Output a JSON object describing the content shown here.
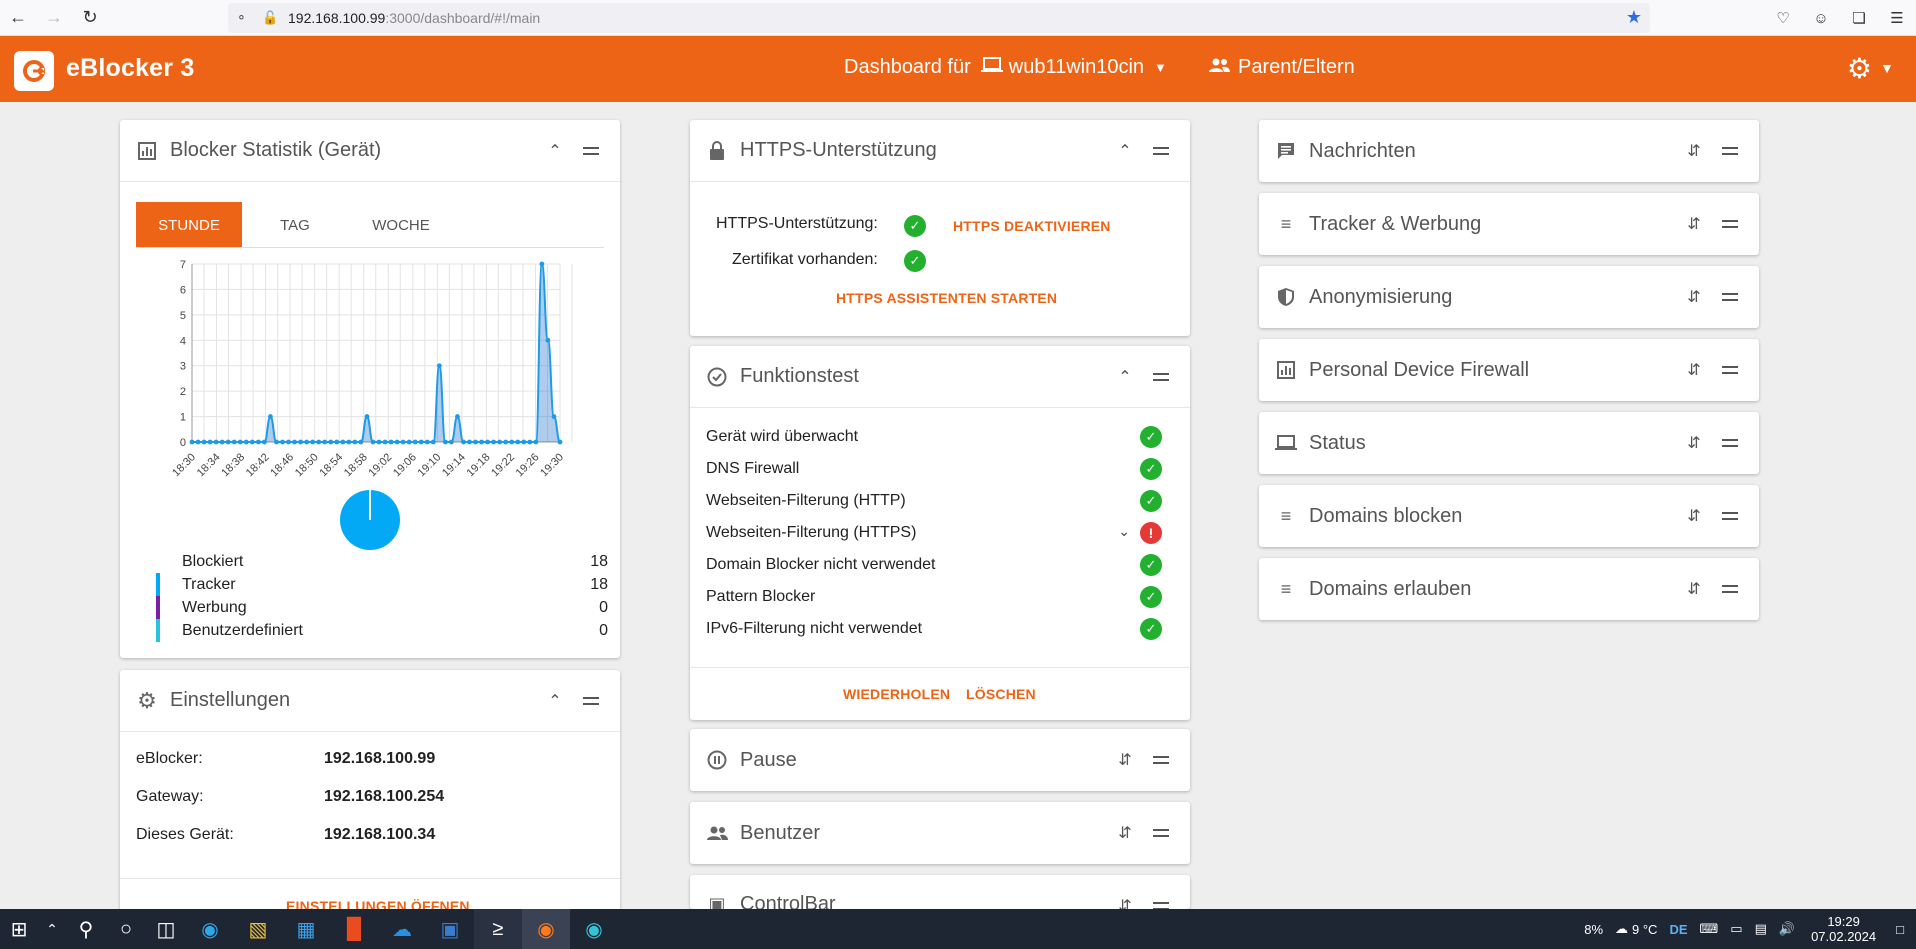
{
  "browser": {
    "url_host": "192.168.100.99",
    "url_path": ":3000/dashboard/#!/main"
  },
  "header": {
    "app_name": "eBlocker 3",
    "dashboard_label": "Dashboard für",
    "device_name": "wub11win10cin",
    "parent_label": "Parent/Eltern"
  },
  "blocker": {
    "title": "Blocker Statistik (Gerät)",
    "tabs": [
      "STUNDE",
      "TAG",
      "WOCHE"
    ],
    "active_tab": "STUNDE",
    "legend": [
      {
        "label": "Blockiert",
        "value": "18",
        "color": ""
      },
      {
        "label": "Tracker",
        "value": "18",
        "color": "#03a9f4"
      },
      {
        "label": "Werbung",
        "value": "0",
        "color": "#7b1fa2"
      },
      {
        "label": "Benutzerdefiniert",
        "value": "0",
        "color": "#26c6da"
      }
    ]
  },
  "chart_data": {
    "type": "area",
    "x": [
      "18:30",
      "18:34",
      "18:38",
      "18:42",
      "18:46",
      "18:50",
      "18:54",
      "18:58",
      "19:02",
      "19:06",
      "19:10",
      "19:14",
      "19:18",
      "19:22",
      "19:26",
      "19:30"
    ],
    "x_minutes_step": 1,
    "values": [
      0,
      0,
      0,
      0,
      0,
      0,
      0,
      0,
      0,
      0,
      0,
      0,
      0,
      1,
      0,
      0,
      0,
      0,
      0,
      0,
      0,
      0,
      0,
      0,
      0,
      0,
      0,
      0,
      0,
      1,
      0,
      0,
      0,
      0,
      0,
      0,
      0,
      0,
      0,
      0,
      0,
      3,
      0,
      0,
      1,
      0,
      0,
      0,
      0,
      0,
      0,
      0,
      0,
      0,
      0,
      0,
      0,
      0,
      7,
      4,
      1,
      0
    ],
    "ylim": [
      0,
      7
    ],
    "yticks": [
      0,
      1,
      2,
      3,
      4,
      5,
      6,
      7
    ],
    "grid": true,
    "series_color": "#1e9be8",
    "pie": {
      "slices": [
        {
          "label": "Tracker",
          "value": 18,
          "color": "#03a9f4"
        }
      ]
    }
  },
  "settings": {
    "title": "Einstellungen",
    "rows": [
      {
        "label": "eBlocker:",
        "value": "192.168.100.99"
      },
      {
        "label": "Gateway:",
        "value": "192.168.100.254"
      },
      {
        "label": "Dieses Gerät:",
        "value": "192.168.100.34"
      }
    ],
    "open_button": "EINSTELLUNGEN ÖFFNEN"
  },
  "https": {
    "title": "HTTPS-Unterstützung",
    "support_label": "HTTPS-Unterstützung:",
    "cert_label": "Zertifikat vorhanden:",
    "deactivate": "HTTPS DEAKTIVIEREN",
    "wizard": "HTTPS ASSISTENTEN STARTEN"
  },
  "functest": {
    "title": "Funktionstest",
    "items": [
      {
        "label": "Gerät wird überwacht",
        "status": "ok"
      },
      {
        "label": "DNS Firewall",
        "status": "ok"
      },
      {
        "label": "Webseiten-Filterung (HTTP)",
        "status": "ok"
      },
      {
        "label": "Webseiten-Filterung (HTTPS)",
        "status": "error"
      },
      {
        "label": "Domain Blocker nicht verwendet",
        "status": "ok"
      },
      {
        "label": "Pattern Blocker",
        "status": "ok"
      },
      {
        "label": "IPv6-Filterung nicht verwendet",
        "status": "ok"
      }
    ],
    "repeat": "WIEDERHOLEN",
    "delete": "LÖSCHEN"
  },
  "mid_cards": {
    "pause": "Pause",
    "users": "Benutzer",
    "controlbar": "ControlBar"
  },
  "right_cards": [
    {
      "title": "Nachrichten",
      "icon": "message-icon"
    },
    {
      "title": "Tracker & Werbung",
      "icon": "list-icon"
    },
    {
      "title": "Anonymisierung",
      "icon": "shield-icon"
    },
    {
      "title": "Personal Device Firewall",
      "icon": "bar-chart-icon"
    },
    {
      "title": "Status",
      "icon": "laptop-icon"
    },
    {
      "title": "Domains blocken",
      "icon": "list-icon"
    },
    {
      "title": "Domains erlauben",
      "icon": "list-icon"
    }
  ],
  "taskbar": {
    "battery": "8%",
    "weather": "9 °C",
    "lang": "DE",
    "time": "19:29",
    "date": "07.02.2024"
  },
  "colors": {
    "accent": "#ee6417",
    "ok": "#22b02e",
    "error": "#e53935"
  }
}
